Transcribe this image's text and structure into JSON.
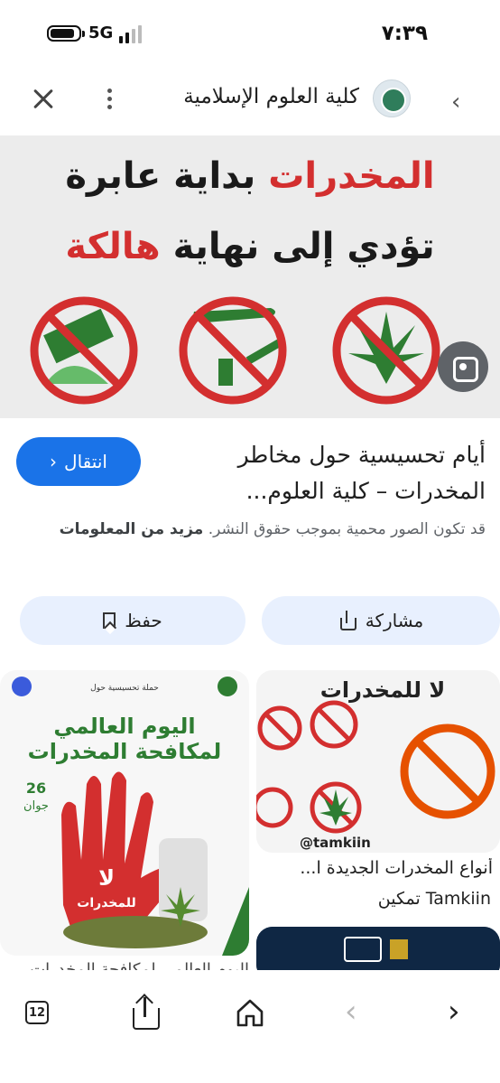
{
  "status_bar": {
    "network": "5G",
    "time": "٧:٣٩"
  },
  "header": {
    "site_name": "كلية العلوم الإسلامية",
    "back_glyph": "‹"
  },
  "hero": {
    "line1_red": "المخدرات",
    "line1_rest": " بداية عابرة",
    "line2_rest": "تؤدي إلى نهاية ",
    "line2_red": "هالكة"
  },
  "result": {
    "visit_label": "انتقال",
    "visit_glyph": "‹",
    "title": "أيام تحسيسية حول مخاطر المخدرات – كلية العلوم...",
    "copyright_text": "قد تكون الصور محمية بموجب حقوق النشر.",
    "more_info": "مزيد من المعلومات"
  },
  "actions": {
    "share_label": "مشاركة",
    "save_label": "حفظ"
  },
  "related": {
    "right_title": "أنواع المخدرات الجديدة ا...",
    "right_source": "Tamkiin تمكين",
    "right_overlay_title": "لا للمخدرات",
    "right_handle": "@tamkiin",
    "left_header": "حملة تحسيسية حول",
    "left_title1": "اليوم العالمي",
    "left_title2": "لمكافحة المخدرات",
    "left_date_day": "26",
    "left_date_month": "جوان",
    "left_badge_no": "لا",
    "left_badge_text": "للمخدرات",
    "left_caption": "اليوم العالمي لمكافحة المخدرات"
  },
  "toolbar": {
    "tabs_count": "12",
    "back_glyph": "‹",
    "forward_glyph": "›"
  },
  "colors": {
    "accent": "#1a73e8",
    "pill_bg": "#e8f0fe",
    "warning_red": "#d32f2f",
    "hero_bg": "#ececec"
  }
}
